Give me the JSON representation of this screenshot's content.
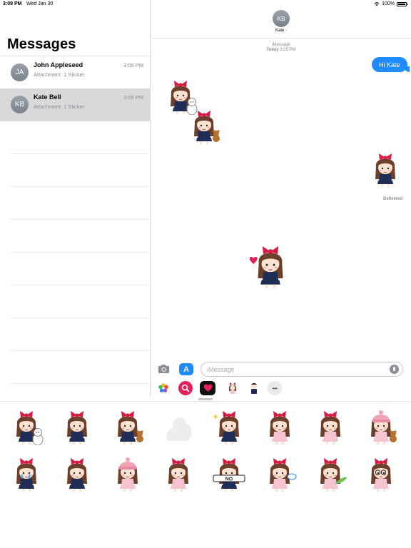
{
  "status_bar": {
    "time": "3:09 PM",
    "date": "Wed Jan 30",
    "battery": "100%"
  },
  "sidebar": {
    "title": "Messages",
    "conversations": [
      {
        "initials": "JA",
        "name": "John Appleseed",
        "time": "3:09 PM",
        "preview": "Attachment: 1 Sticker",
        "selected": false
      },
      {
        "initials": "KB",
        "name": "Kate Bell",
        "time": "3:09 PM",
        "preview": "Attachment: 1 Sticker",
        "selected": true
      }
    ]
  },
  "chat": {
    "contact_initials": "KB",
    "contact_name": "Kate",
    "chevron": "›",
    "service": "iMessage",
    "timestamp_day": "Today",
    "timestamp_time": "3:05 PM",
    "sent_message": "Hi Kate",
    "delivered_label": "Delivered",
    "input_placeholder": "iMessage"
  },
  "drawer": {
    "apps": [
      "photos-app",
      "search-images-app",
      "heart-app",
      "sticker-app-1",
      "sticker-app-2",
      "more-apps"
    ],
    "more_label": "•••"
  },
  "sticker_panel": {
    "rows": [
      [
        "girl-with-white-cat",
        "girl-standing",
        "girl-with-teddy-bear",
        "empty-placeholder",
        "girl-sparkles",
        "girl-pink-dress",
        "girl-pink-dress-2",
        "girl-beanie-teddy"
      ],
      [
        "girl-crying",
        "girl-navy-outfit",
        "girl-beanie-pink",
        "girl-pink-outfit",
        "girl-no-sign",
        "girl-speech-bubble",
        "girl-holding-leaf",
        "girl-glasses"
      ]
    ]
  },
  "colors": {
    "accent_blue": "#1f8bff",
    "bow_red": "#d81b43",
    "hair_brown": "#6b3f2a",
    "navy": "#1f2d57",
    "pink": "#f6c3d1"
  }
}
